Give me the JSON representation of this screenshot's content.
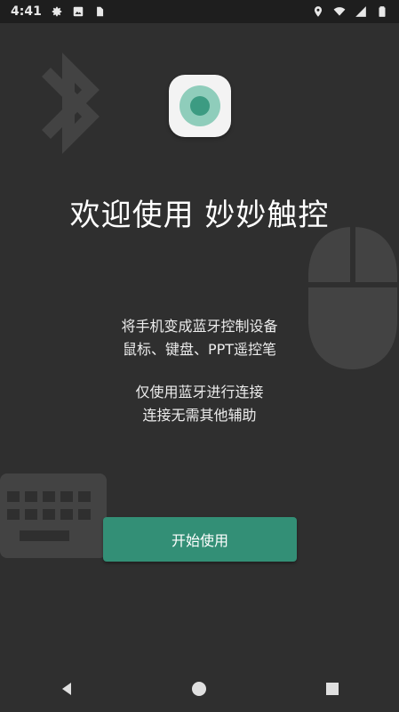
{
  "status_bar": {
    "time": "4:41",
    "left_icons": [
      "gear-icon",
      "image-icon",
      "sim-card-icon"
    ],
    "right_icons": [
      "location-icon",
      "wifi-icon",
      "signal-icon",
      "battery-icon"
    ]
  },
  "app": {
    "title": "欢迎使用 妙妙触控",
    "description_lines_1": [
      "将手机变成蓝牙控制设备",
      "鼠标、键盘、PPT遥控笔"
    ],
    "description_lines_2": [
      "仅使用蓝牙进行连接",
      "连接无需其他辅助"
    ],
    "start_button_label": "开始使用",
    "colors": {
      "background": "#2f2f2f",
      "accent": "#338f76",
      "icon_ring": "#8fcdbb",
      "icon_dot": "#3c9b82"
    }
  },
  "nav_bar": {
    "buttons": [
      "back-icon",
      "home-icon",
      "recents-icon"
    ]
  }
}
